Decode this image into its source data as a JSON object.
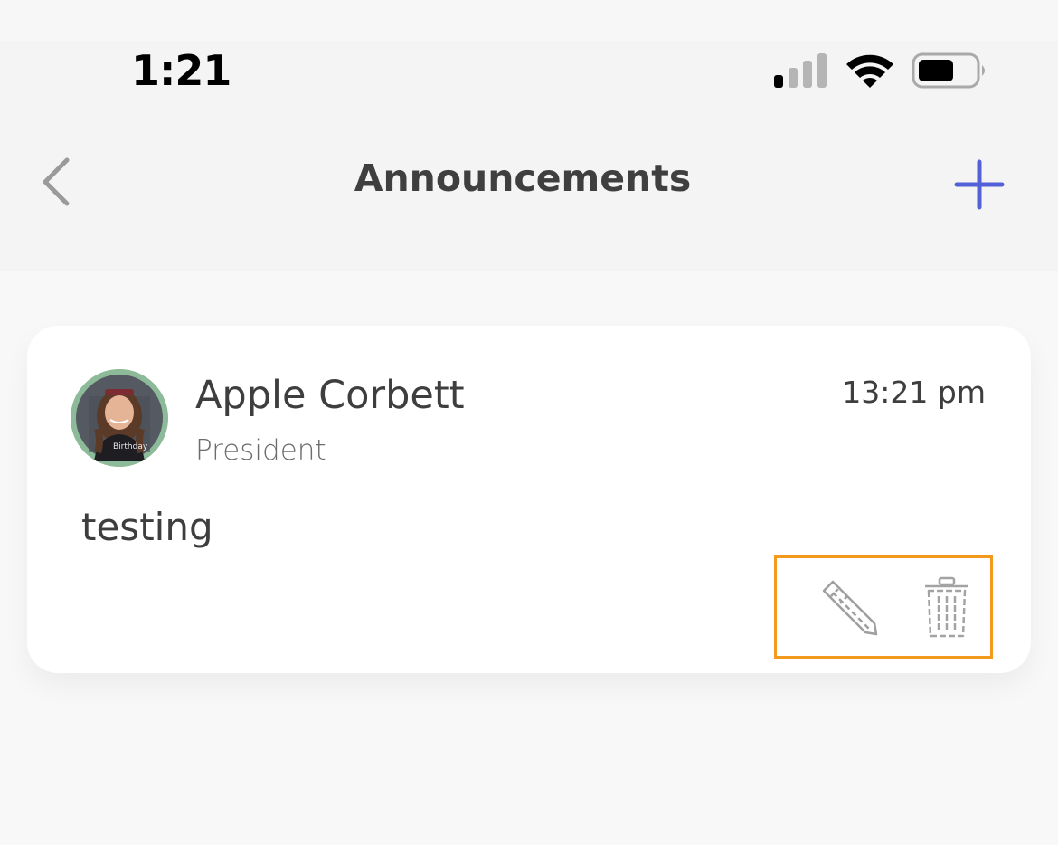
{
  "status_bar": {
    "time": "1:21",
    "icons": [
      "cellular-signal-icon",
      "wifi-icon",
      "battery-icon"
    ]
  },
  "nav": {
    "title": "Announcements",
    "back_icon": "chevron-left-icon",
    "add_icon": "plus-icon",
    "accent_color": "#5360d8"
  },
  "announcements": [
    {
      "author_name": "Apple Corbett",
      "author_role": "President",
      "time": "13:21 pm",
      "body": "testing",
      "avatar_icon": "avatar",
      "actions": {
        "edit_icon": "pencil-icon",
        "delete_icon": "trash-icon"
      }
    }
  ],
  "colors": {
    "highlight_border": "#f39a1c",
    "avatar_ring": "#8dbb99",
    "text_dark": "#3e3e3e"
  }
}
